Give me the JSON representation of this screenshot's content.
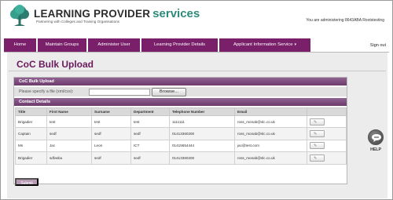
{
  "brand": {
    "name_main": "LEARNING PROVIDER",
    "name_accent": "services",
    "tagline": "Partnering with Colleges and Training Organisations"
  },
  "header": {
    "admin_note": "You are administering 8643ABA Rootstesting"
  },
  "nav": {
    "items": [
      {
        "label": "Home"
      },
      {
        "label": "Maintain Groups"
      },
      {
        "label": "Administer User"
      },
      {
        "label": "Learning Provider Details"
      },
      {
        "label": "Applicant Information Service"
      }
    ],
    "signout_label": "Sign out"
  },
  "page": {
    "title": "CoC Bulk Upload"
  },
  "upload": {
    "section_title": "CoC Bulk Upload",
    "prompt": "Please specify a file (xml/csv):",
    "file_value": "",
    "browse_label": "Browse..."
  },
  "contacts": {
    "section_title": "Contact Details",
    "columns": [
      "Title",
      "First Name",
      "Surname",
      "Department",
      "Telephone Number",
      "Email",
      ""
    ],
    "rows": [
      {
        "title": "Brigadier",
        "first_name": "test",
        "surname": "test",
        "department": "test",
        "telephone": "1111111",
        "email": "ross_monab@slc.co.uk"
      },
      {
        "title": "Captain",
        "first_name": "sedf",
        "surname": "sedf",
        "department": "sedf",
        "telephone": "01413360200",
        "email": "ross_monab@slc.co.uk"
      },
      {
        "title": "Ms",
        "first_name": "Jac",
        "surname": "Leon",
        "department": "ICT",
        "telephone": "01415554444",
        "email": "jac@test.com"
      },
      {
        "title": "Brigadier",
        "first_name": "sdfasba",
        "surname": "sedf",
        "department": "sedf",
        "telephone": "01413360200",
        "email": "ross_monab@slc.co.uk"
      }
    ]
  },
  "actions": {
    "submit_label": "Submit"
  },
  "help": {
    "label": "HELP"
  },
  "colors": {
    "brand_purple": "#7a1f6a",
    "title_purple": "#6a1a5c",
    "accent_teal": "#2d8a7a"
  },
  "icons": {
    "logo": "tree-logo-icon",
    "help": "help-icon",
    "row_edit": "pencil-icon",
    "nav_caret": "caret-down-icon"
  }
}
